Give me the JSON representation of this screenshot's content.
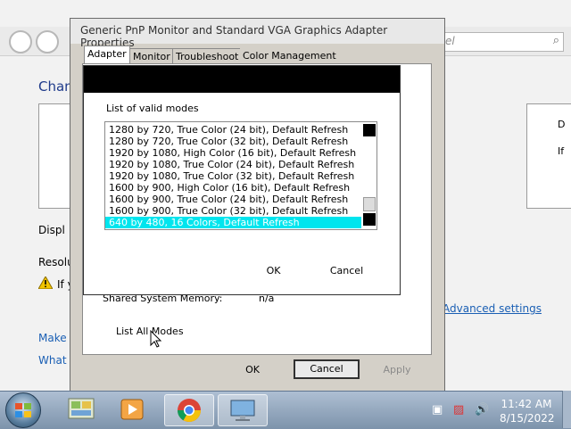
{
  "background_window": {
    "search_placeholder": "el",
    "heading_partial": "Chan",
    "display_label": "Displ",
    "resolution_label": "Resolu",
    "warning_text": "If y",
    "make_link": "Make t",
    "what_link": "What c",
    "advanced_link": "Advanced settings",
    "right_box_lines": [
      "D",
      "If"
    ]
  },
  "properties_dialog": {
    "title": "Generic PnP Monitor and Standard VGA Graphics Adapter Properties",
    "tabs": [
      "Adapter",
      "Monitor",
      "Troubleshoot",
      "Color Management"
    ],
    "shared_memory_label": "Shared System Memory:",
    "shared_memory_value": "n/a",
    "list_all_modes_label": "List All Modes",
    "ok_label": "OK",
    "cancel_label": "Cancel",
    "apply_label": "Apply"
  },
  "modes_dialog": {
    "label": "List of valid modes",
    "modes": [
      "1280 by 720, True Color (24 bit), Default Refresh",
      "1280 by 720, True Color (32 bit), Default Refresh",
      "1920 by 1080, High Color (16 bit), Default Refresh",
      "1920 by 1080, True Color (24 bit), Default Refresh",
      "1920 by 1080, True Color (32 bit), Default Refresh",
      "1600 by 900, High Color (16 bit), Default Refresh",
      "1600 by 900, True Color (24 bit), Default Refresh",
      "1600 by 900, True Color (32 bit), Default Refresh",
      "640 by 480, 16 Colors, Default Refresh"
    ],
    "selected_index": 8,
    "ok_label": "OK",
    "cancel_label": "Cancel"
  },
  "taskbar": {
    "time": "11:42 AM",
    "date": "8/15/2022",
    "pinned": [
      "control-panel",
      "media-player",
      "chrome",
      "display-settings"
    ]
  },
  "colors": {
    "selection": "#00e5ee",
    "dialog_face": "#d4d0c8",
    "link": "#1a5fb4"
  }
}
